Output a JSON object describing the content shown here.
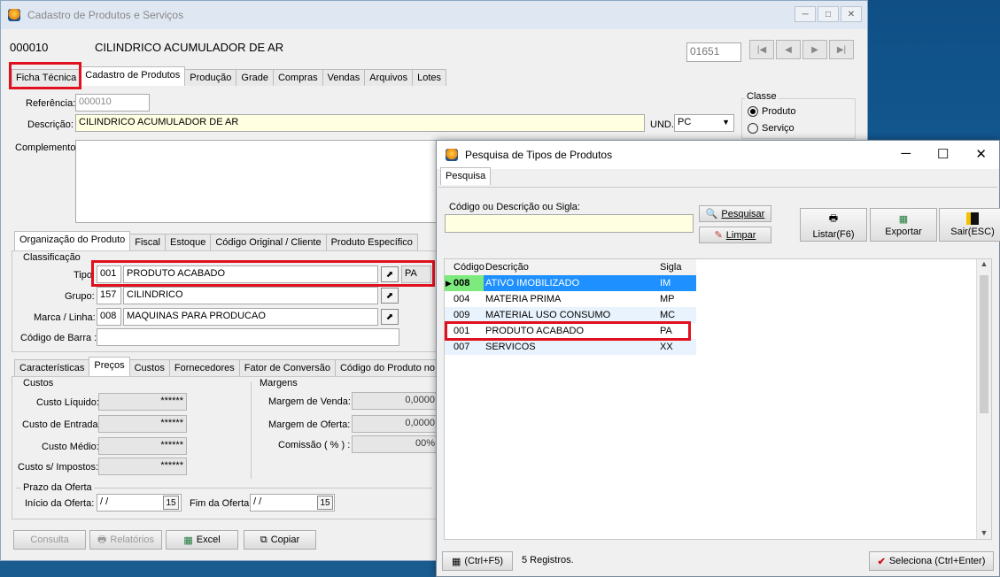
{
  "main": {
    "title": "Cadastro de Produtos e Serviços",
    "window_controls": [
      "─",
      "□",
      "✕"
    ],
    "product_code": "000010",
    "product_name": "CILINDRICO ACUMULADOR DE AR",
    "record_field": "01651",
    "nav": [
      "|◀",
      "◀",
      "▶",
      "▶|"
    ],
    "tabs": [
      "Ficha Técnica",
      "Cadastro de Produtos",
      "Produção",
      "Grade",
      "Compras",
      "Vendas",
      "Arquivos",
      "Lotes"
    ],
    "referencia_label": "Referência:",
    "referencia_value": "000010",
    "descricao_label": "Descrição:",
    "descricao_value": "CILINDRICO ACUMULADOR DE AR",
    "und_label": "UND.:",
    "und_value": "PC",
    "classe_label": "Classe",
    "classe_options": [
      "Produto",
      "Serviço"
    ],
    "complemento_label": "Complemento:",
    "org_tabs": [
      "Organização do Produto",
      "Fiscal",
      "Estoque",
      "Código Original / Cliente",
      "Produto Específico"
    ],
    "classificacao_label": "Classificação",
    "tipo_label": "Tipo:",
    "tipo_code": "001",
    "tipo_desc": "PRODUTO ACABADO",
    "tipo_sigla": "PA",
    "grupo_label": "Grupo:",
    "grupo_code": "157",
    "grupo_desc": "CILINDRICO",
    "marca_label": "Marca / Linha:",
    "marca_code": "008",
    "marca_desc": "MAQUINAS PARA PRODUCAO",
    "barra_label": "Código de Barra :",
    "price_tabs": [
      "Características",
      "Preços",
      "Custos",
      "Fornecedores",
      "Fator de Conversão",
      "Código do Produto no"
    ],
    "custos_label": "Custos",
    "custo_rows": [
      {
        "label": "Custo Líquido:",
        "value": "******"
      },
      {
        "label": "Custo de Entrada:",
        "value": "******"
      },
      {
        "label": "Custo Médio:",
        "value": "******"
      },
      {
        "label": "Custo s/ Impostos:",
        "value": "******"
      }
    ],
    "margens_label": "Margens",
    "margem_rows": [
      {
        "label": "Margem de Venda:",
        "value": "0,0000"
      },
      {
        "label": "Margem de Oferta:",
        "value": "0,0000"
      },
      {
        "label": "Comissão ( % ) :",
        "value": "00%"
      }
    ],
    "prazo_label": "Prazo da Oferta",
    "inicio_label": "Início da Oferta:",
    "inicio_value": " /  /",
    "fim_label": "Fim da Oferta:",
    "fim_value": " /  /",
    "cal_icon": "15",
    "buttons": {
      "consulta": "Consulta",
      "relatorios": "Relatórios",
      "excel": "Excel",
      "copiar": "Copiar"
    }
  },
  "dialog": {
    "title": "Pesquisa de Tipos de Produtos",
    "window_controls": [
      "─",
      "☐",
      "✕"
    ],
    "tab": "Pesquisa",
    "search_label": "Código ou  Descrição ou  Sigla:",
    "search_value": "",
    "pesquisar": "Pesquisar",
    "limpar": "Limpar",
    "listar": "Listar(F6)",
    "exportar": "Exportar",
    "sair": "Sair(ESC)",
    "columns": [
      "Código",
      "Descrição",
      "Sigla"
    ],
    "rows": [
      {
        "code": "008",
        "desc": "ATIVO IMOBILIZADO",
        "sigla": "IM"
      },
      {
        "code": "004",
        "desc": "MATERIA PRIMA",
        "sigla": "MP"
      },
      {
        "code": "009",
        "desc": "MATERIAL USO CONSUMO",
        "sigla": "MC"
      },
      {
        "code": "001",
        "desc": "PRODUTO ACABADO",
        "sigla": "PA"
      },
      {
        "code": "007",
        "desc": "SERVICOS",
        "sigla": "XX"
      }
    ],
    "ctrl_f5": "(Ctrl+F5)",
    "count": "5 Registros.",
    "seleciona": "Seleciona (Ctrl+Enter)",
    "colors": {
      "selected_row": "#1e90ff",
      "selected_code": "#7dea7d",
      "highlight": "#e0101e"
    }
  }
}
